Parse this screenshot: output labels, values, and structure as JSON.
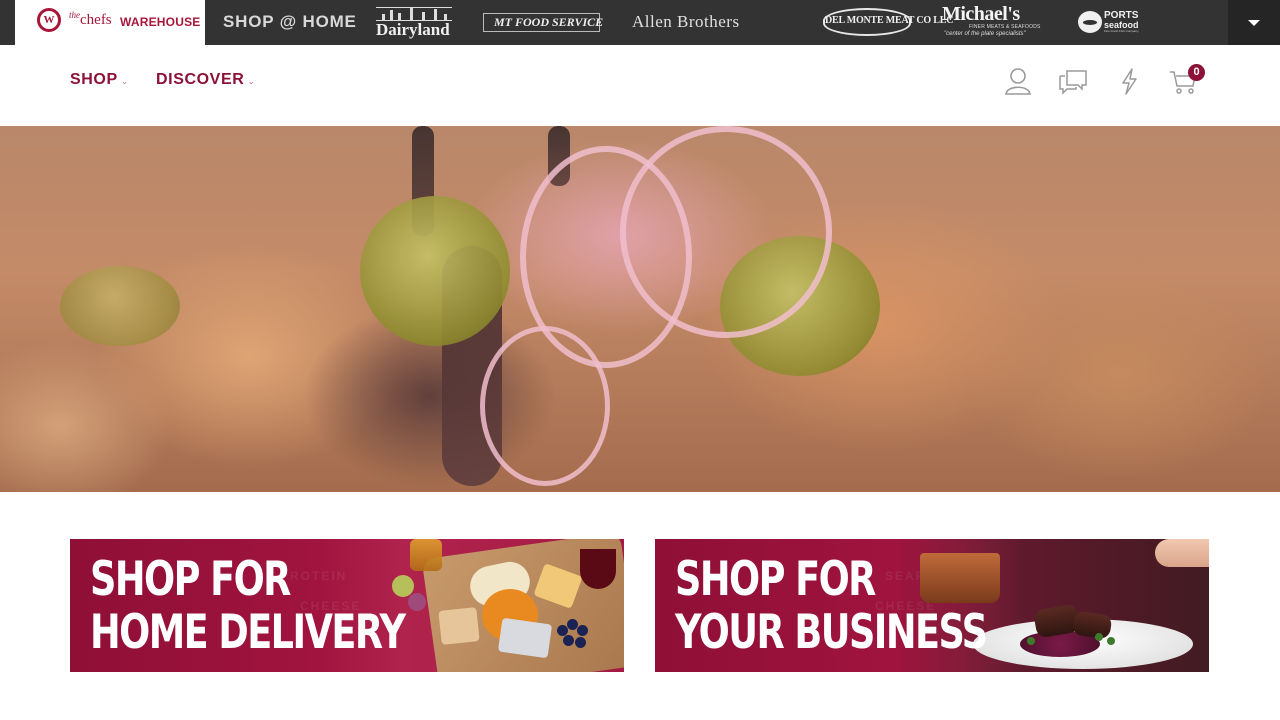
{
  "brands": {
    "home_logo": {
      "the": "the",
      "chefs": "chefs",
      "warehouse": "WAREHOUSE",
      "mark": "W"
    },
    "shop_at_home": "SHOP @ HOME",
    "dairyland": "Dairyland",
    "mt_food": "MT FOOD SERVICE",
    "allen_brothers": "Allen Brothers",
    "del_monte": "DEL MONTE MEAT CO LLC",
    "michaels": {
      "name": "Michael's",
      "tag1": "FINER MEATS & SEAFOODS",
      "tag2": "\"center of the plate specialists\""
    },
    "ports": {
      "l1": "PORTS",
      "l2": "seafood",
      "l3": "Fine Fresh Fish Company"
    }
  },
  "nav": {
    "shop": "SHOP",
    "discover": "DISCOVER",
    "cart_count": "0"
  },
  "promos": {
    "home": {
      "line1": "SHOP FOR",
      "line2": "HOME DELIVERY"
    },
    "business": {
      "line1": "SHOP FOR",
      "line2": "YOUR BUSINESS"
    }
  },
  "colors": {
    "accent": "#8c1238",
    "brandbar": "#333333",
    "promo": "#a0143f"
  }
}
